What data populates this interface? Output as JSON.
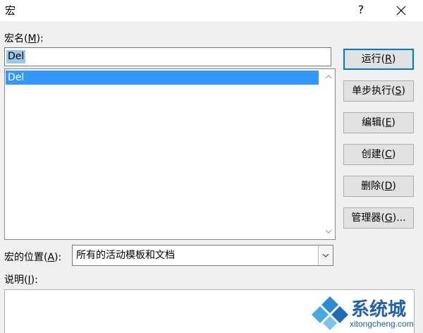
{
  "window": {
    "title": "宏",
    "help_glyph": "?"
  },
  "macro_name": {
    "label_prefix": "宏名(",
    "label_key": "M",
    "label_suffix": "):",
    "value": "Del"
  },
  "macro_list": {
    "items": [
      "Del"
    ],
    "selected": "Del"
  },
  "buttons": {
    "run": {
      "prefix": "运行(",
      "key": "R",
      "suffix": ")"
    },
    "step_into": {
      "prefix": "单步执行(",
      "key": "S",
      "suffix": ")"
    },
    "edit": {
      "prefix": "编辑(",
      "key": "E",
      "suffix": ")"
    },
    "create": {
      "prefix": "创建(",
      "key": "C",
      "suffix": ")"
    },
    "delete": {
      "prefix": "删除(",
      "key": "D",
      "suffix": ")"
    },
    "organizer": {
      "prefix": "管理器(",
      "key": "G",
      "suffix": ")..."
    }
  },
  "macros_in": {
    "label_prefix": "宏的位置(",
    "label_key": "A",
    "label_suffix": "):",
    "value": "所有的活动模板和文档"
  },
  "description": {
    "label_prefix": "说明(",
    "label_key": "I",
    "label_suffix": "):",
    "text": ""
  },
  "watermark": {
    "title": "系统城",
    "url": "xitongcheng.com"
  },
  "colors": {
    "selection": "#3399ff",
    "default_button_border": "#0078d7",
    "watermark": "#1e5fae"
  }
}
